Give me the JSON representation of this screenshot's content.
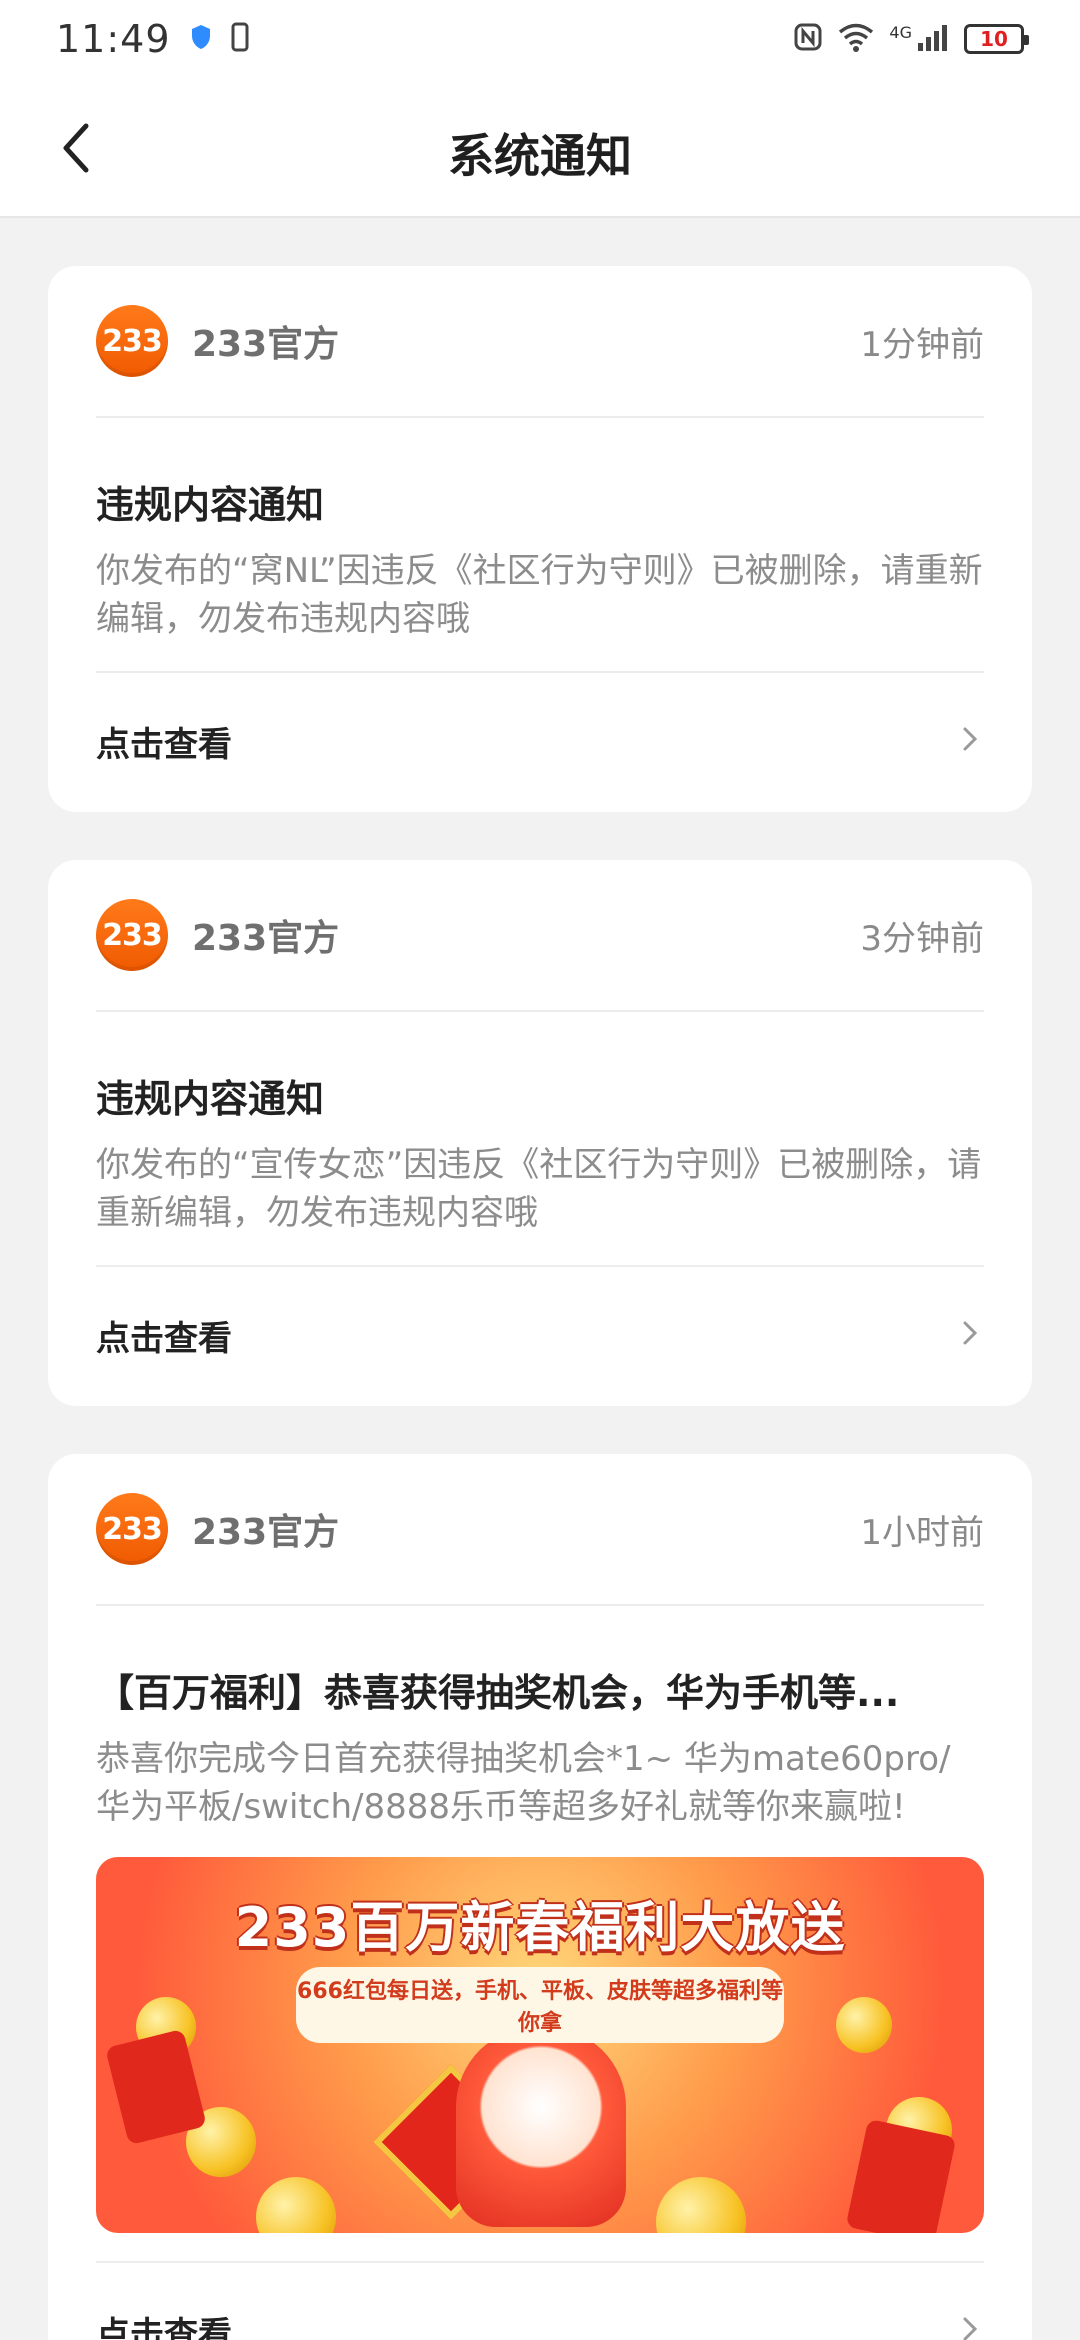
{
  "status_bar": {
    "time": "11:49",
    "battery": "10",
    "network": "4G"
  },
  "header": {
    "title": "系统通知",
    "back_icon": "chevron-left-icon"
  },
  "notifications": [
    {
      "sender": "233官方",
      "logo_text": "233",
      "time_ago": "1分钟前",
      "title": "违规内容通知",
      "body": "你发布的“窝NL”因违反《社区行为守则》已被删除，请重新编辑，勿发布违规内容哦",
      "action": "点击查看"
    },
    {
      "sender": "233官方",
      "logo_text": "233",
      "time_ago": "3分钟前",
      "title": "违规内容通知",
      "body": "你发布的“宣传女恋”因违反《社区行为守则》已被删除，请重新编辑，勿发布违规内容哦",
      "action": "点击查看"
    },
    {
      "sender": "233官方",
      "logo_text": "233",
      "time_ago": "1小时前",
      "title": "【百万福利】恭喜获得抽奖机会，华为手机等...",
      "body": "恭喜你完成今日首充获得抽奖机会*1~ 华为mate60pro/华为平板/switch/8888乐币等超多好礼就等你来赢啦!",
      "banner_title": "233百万新春福利大放送",
      "banner_subtitle": "666红包每日送，手机、平板、皮肤等超多福利等你拿",
      "action": "点击查看"
    }
  ],
  "colors": {
    "brand_orange": "#f05a00",
    "background": "#f2f2f2",
    "card": "#ffffff"
  }
}
